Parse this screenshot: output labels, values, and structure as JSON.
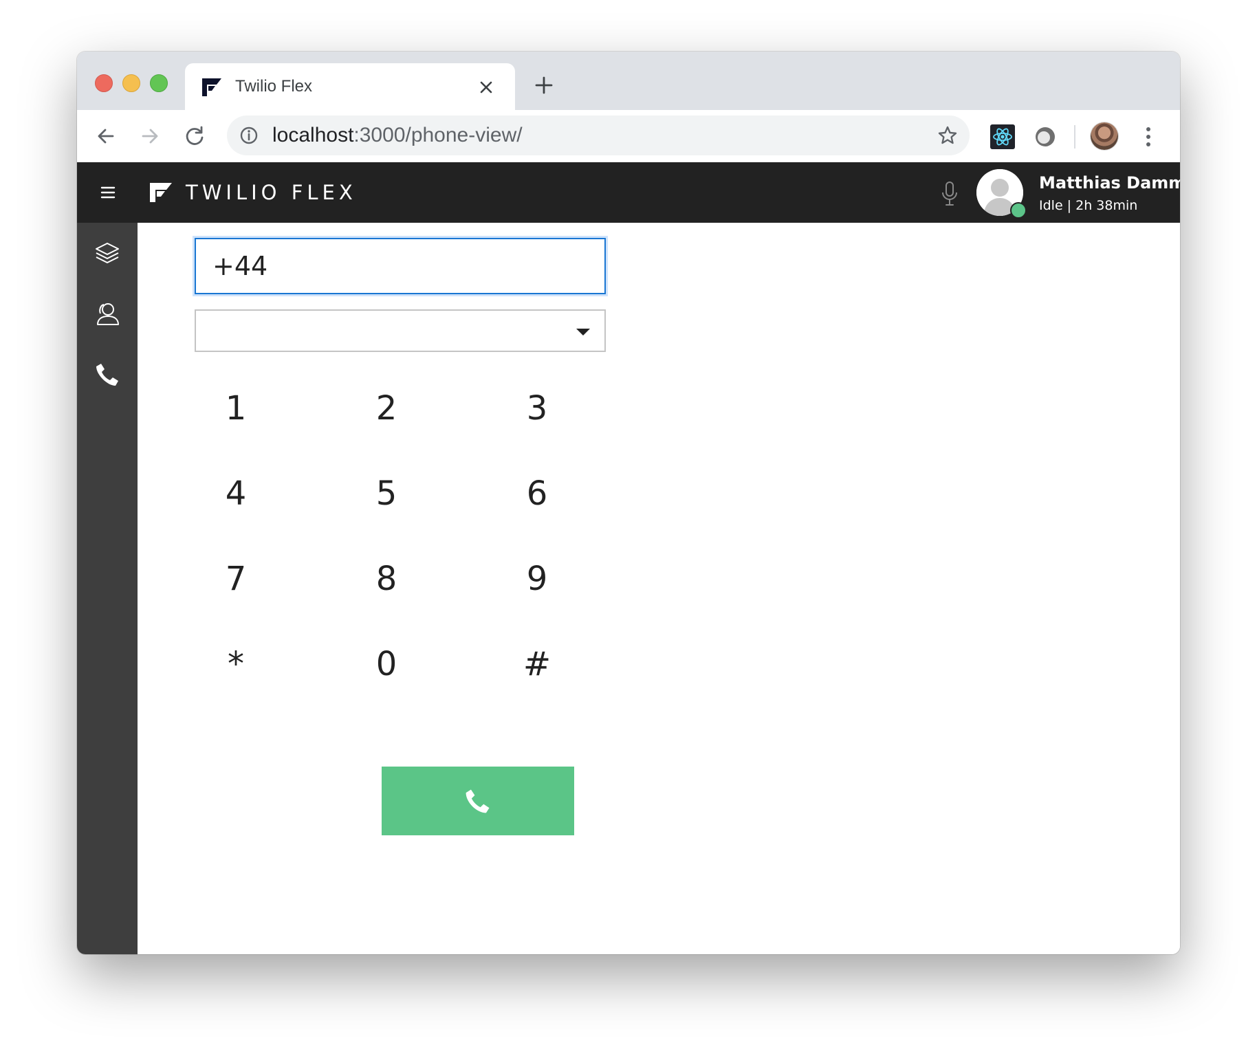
{
  "browser": {
    "tab": {
      "title": "Twilio Flex",
      "favicon": "twilio-flex-logo-icon",
      "close_icon": "close-icon"
    },
    "new_tab_icon": "plus-icon",
    "nav": {
      "back_icon": "arrow-back-icon",
      "forward_icon": "arrow-forward-icon",
      "reload_icon": "reload-icon"
    },
    "address": {
      "host": "localhost",
      "rest": ":3000/phone-view/",
      "info_icon": "info-icon",
      "bookmark_icon": "star-icon"
    },
    "extensions": [
      "react-devtools-icon",
      "extension-circle-icon"
    ],
    "menu_icon": "more-vert-icon"
  },
  "header": {
    "menu_icon": "hamburger-icon",
    "brand": "TWILIO FLEX",
    "mic_icon": "microphone-icon",
    "user": {
      "name": "Matthias Damm",
      "status": "Idle | 2h 38min",
      "status_color": "#5cc489"
    }
  },
  "sidebar": {
    "items": [
      {
        "icon": "layers-icon",
        "label": ""
      },
      {
        "icon": "agents-icon",
        "label": ""
      },
      {
        "icon": "phone-icon",
        "label": ""
      }
    ]
  },
  "dialer": {
    "number_value": "+44",
    "caller_id_value": "",
    "keys": [
      "1",
      "2",
      "3",
      "4",
      "5",
      "6",
      "7",
      "8",
      "9",
      "*",
      "0",
      "#"
    ],
    "call_icon": "phone-icon",
    "call_color": "#5bc587"
  },
  "colors": {
    "header_bg": "#222222",
    "sidebar_bg": "#3e3e3e",
    "input_focus": "#1976d2",
    "call_button": "#5bc587"
  }
}
